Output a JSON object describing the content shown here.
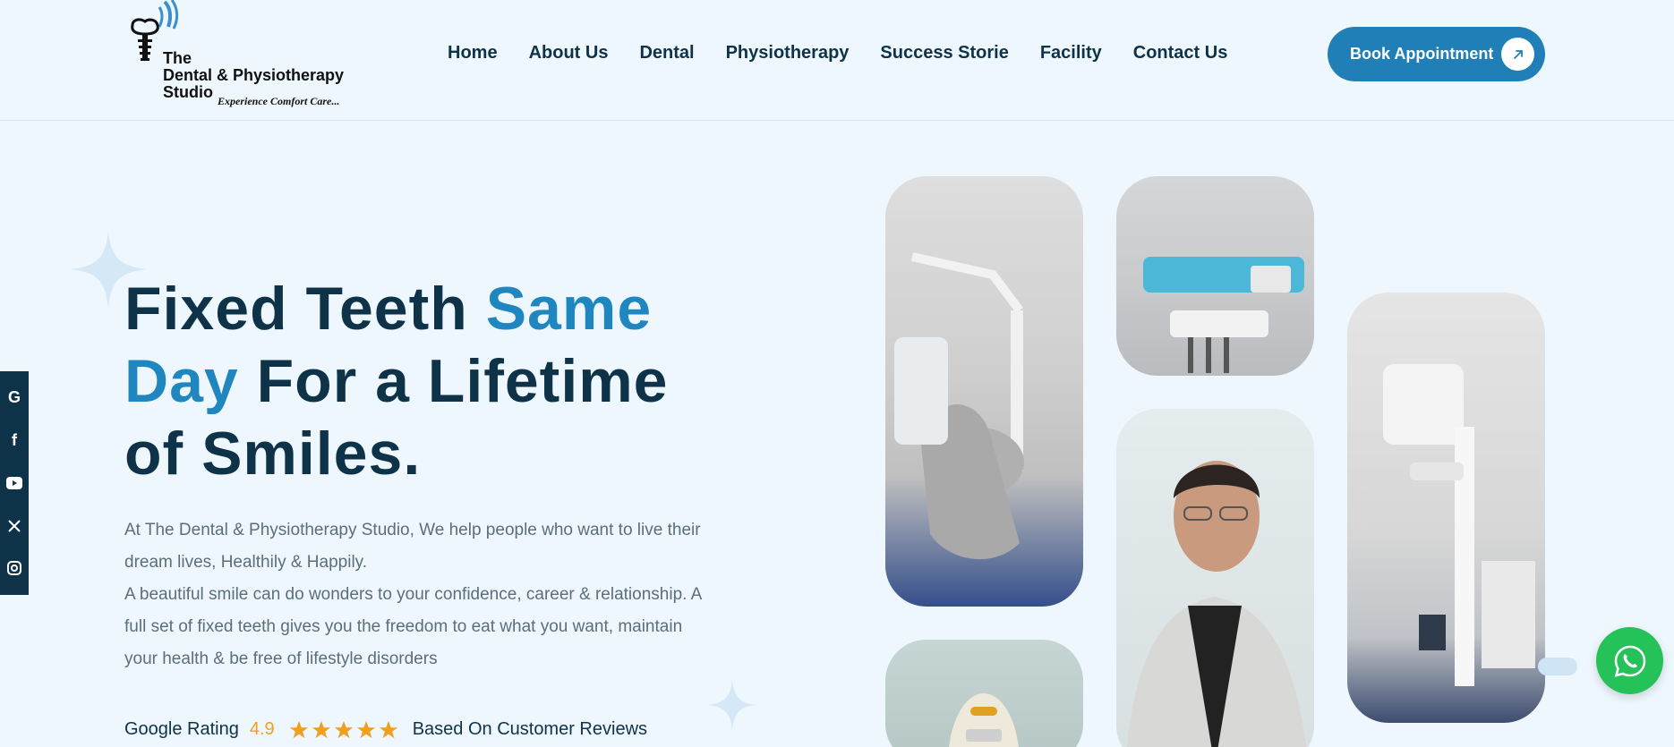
{
  "header": {
    "logo": {
      "line1": "The",
      "line2": "Dental & Physiotherapy",
      "line3": "Studio",
      "tagline": "Experience Comfort Care..."
    },
    "nav": [
      {
        "label": "Home"
      },
      {
        "label": "About Us"
      },
      {
        "label": "Dental"
      },
      {
        "label": "Physiotherapy"
      },
      {
        "label": "Success Storie"
      },
      {
        "label": "Facility"
      },
      {
        "label": "Contact Us"
      }
    ],
    "cta": {
      "label": "Book Appointment",
      "icon": "arrow-up-right-icon"
    }
  },
  "social": [
    {
      "icon": "google-icon",
      "glyph": "G"
    },
    {
      "icon": "facebook-icon",
      "glyph": "f"
    },
    {
      "icon": "youtube-icon",
      "glyph": "▶"
    },
    {
      "icon": "x-icon",
      "glyph": "X"
    },
    {
      "icon": "instagram-icon",
      "glyph": "◎"
    }
  ],
  "hero": {
    "title_part1": "Fixed Teeth ",
    "title_accent1": "Same",
    "title_accent2": "Day",
    "title_part2": " For a Lifetime",
    "title_part3": "of Smiles.",
    "paragraph1": "At The Dental & Physiotherapy Studio, We help people who want to live their dream lives, Healthily & Happily.",
    "paragraph2": "A beautiful smile can do wonders to your confidence, career & relationship. A full set of fixed teeth gives you the freedom to eat what you want, maintain your health & be free of lifestyle disorders",
    "rating": {
      "label": "Google Rating",
      "value": "4.9",
      "stars": 5,
      "suffix": "Based On Customer Reviews"
    }
  },
  "colors": {
    "background": "#eef7fd",
    "navy": "#0e3349",
    "accent": "#1f86c0",
    "button": "#1f7fb6",
    "star": "#f0a020",
    "whatsapp": "#25c25a"
  },
  "floating": {
    "whatsapp_icon": "whatsapp-icon"
  }
}
